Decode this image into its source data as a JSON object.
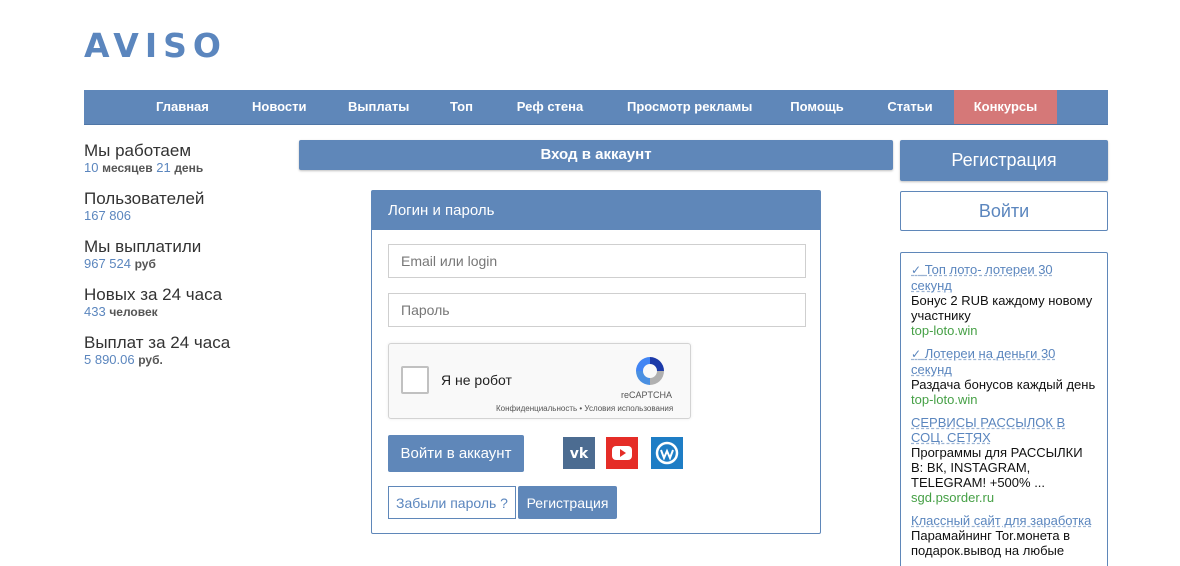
{
  "logo": "AVISO",
  "nav": [
    {
      "label": "Главная"
    },
    {
      "label": "Новости"
    },
    {
      "label": "Выплаты"
    },
    {
      "label": "Топ"
    },
    {
      "label": "Реф стена"
    },
    {
      "label": "Просмотр рекламы"
    },
    {
      "label": "Помощь"
    },
    {
      "label": "Статьи"
    },
    {
      "label": "Конкурсы"
    }
  ],
  "colors": {
    "accent": "#5f87b9",
    "contest": "#d57878",
    "ad_site": "#46a046"
  },
  "stats": [
    {
      "label": "Мы работаем",
      "v1": "10",
      "u1": "месяцев",
      "v2": "21",
      "u2": "день"
    },
    {
      "label": "Пользователей",
      "v1": "167 806",
      "u1": "",
      "v2": "",
      "u2": ""
    },
    {
      "label": "Мы выплатили",
      "v1": "967 524",
      "u1": "руб",
      "v2": "",
      "u2": ""
    },
    {
      "label": "Новых за 24 часа",
      "v1": "433",
      "u1": "человек",
      "v2": "",
      "u2": ""
    },
    {
      "label": "Выплат за 24 часа",
      "v1": "5 890.06",
      "u1": "руб.",
      "v2": "",
      "u2": ""
    }
  ],
  "login": {
    "bar_title": "Вход в аккаунт",
    "panel_title": "Логин и пароль",
    "email_placeholder": "Email или login",
    "password_placeholder": "Пароль",
    "captcha_label": "Я не робот",
    "captcha_brand": "reCAPTCHA",
    "captcha_links": "Конфиденциальность • Условия использования",
    "submit_label": "Войти в аккаунт",
    "forgot_label": "Забыли пароль ?",
    "register_label": "Регистрация",
    "social_icons": [
      "vk-icon",
      "youtube-icon",
      "webmoney-icon"
    ]
  },
  "side": {
    "register_label": "Регистрация",
    "enter_label": "Войти"
  },
  "ads": [
    {
      "check": "✓",
      "title": "Топ лото- лотереи 30 секунд",
      "desc": "Бонус 2 RUB каждому новому участнику",
      "site": "top-loto.win"
    },
    {
      "check": "✓",
      "title": "Лотереи на деньги 30 секунд",
      "desc": "Раздача бонусов каждый день",
      "site": "top-loto.win"
    },
    {
      "check": "",
      "title": "СЕРВИСЫ РАССЫЛОК В СОЦ. СЕТЯХ",
      "desc": "Программы для РАССЫЛКИ В: ВК, INSTAGRAM, TELEGRAM! +500% ...",
      "site": "sgd.psorder.ru"
    },
    {
      "check": "",
      "title": "Классный сайт для заработка",
      "desc": "Парамайнинг Tor.монета в подарок.вывод на любые",
      "site": ""
    }
  ]
}
